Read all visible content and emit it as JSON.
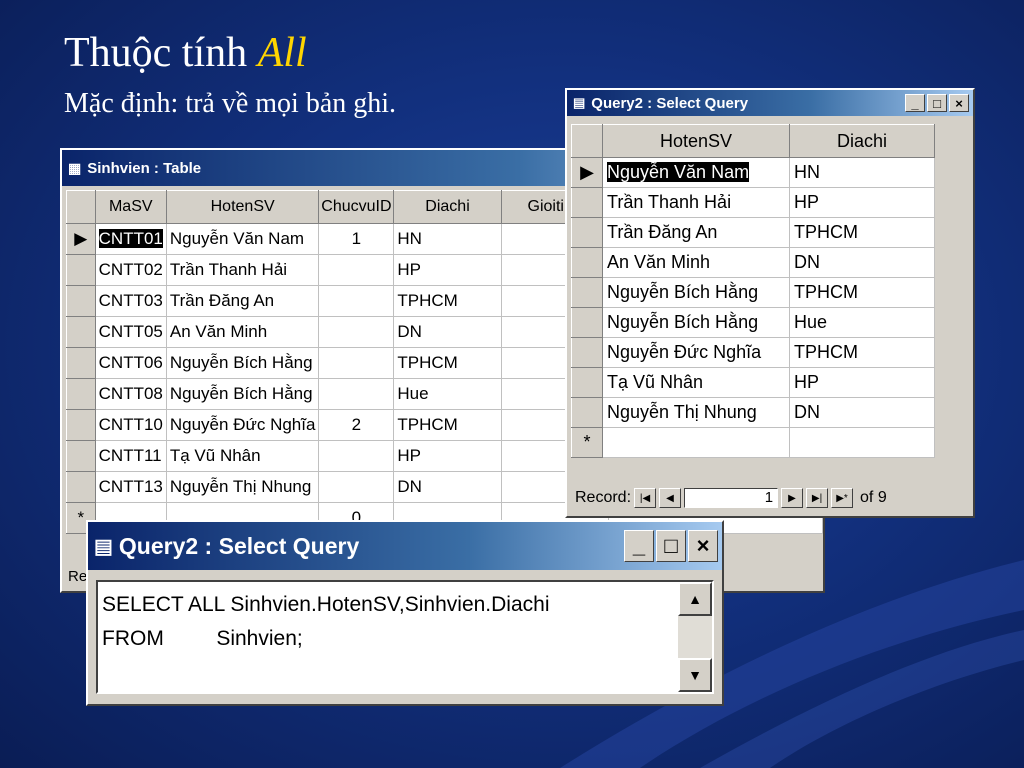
{
  "slide": {
    "title_prefix": "Thuộc tính ",
    "title_keyword": "All",
    "subtitle": "Mặc định: trả về mọi bản ghi."
  },
  "table_window": {
    "title": "Sinhvien : Table",
    "columns": [
      "MaSV",
      "HotenSV",
      "ChucvuID",
      "Diachi",
      "Gioitinh"
    ],
    "rows": [
      [
        "CNTT01",
        "Nguyễn Văn Nam",
        "1",
        "HN",
        ""
      ],
      [
        "CNTT02",
        "Trần Thanh Hải",
        "",
        "HP",
        ""
      ],
      [
        "CNTT03",
        "Trần Đăng An",
        "",
        "TPHCM",
        ""
      ],
      [
        "CNTT05",
        "An Văn Minh",
        "",
        "DN",
        ""
      ],
      [
        "CNTT06",
        "Nguyễn Bích Hằng",
        "",
        "TPHCM",
        ""
      ],
      [
        "CNTT08",
        "Nguyễn Bích Hằng",
        "",
        "Hue",
        ""
      ],
      [
        "CNTT10",
        "Nguyễn Đức Nghĩa",
        "2",
        "TPHCM",
        ""
      ],
      [
        "CNTT11",
        "Tạ Vũ Nhân",
        "",
        "HP",
        ""
      ],
      [
        "CNTT13",
        "Nguyễn Thị Nhung",
        "",
        "DN",
        ""
      ]
    ],
    "new_row_marker": "*",
    "new_row_chucvuid": "0",
    "current_row_marker": "▶",
    "status_partial": "Re"
  },
  "query_window": {
    "title": "Query2 : Select Query",
    "columns": [
      "HotenSV",
      "Diachi"
    ],
    "rows": [
      [
        "Nguyễn Văn Nam",
        "HN"
      ],
      [
        "Trần Thanh Hải",
        "HP"
      ],
      [
        "Trần Đăng An",
        "TPHCM"
      ],
      [
        "An Văn Minh",
        "DN"
      ],
      [
        "Nguyễn Bích Hằng",
        "TPHCM"
      ],
      [
        "Nguyễn Bích Hằng",
        "Hue"
      ],
      [
        "Nguyễn Đức Nghĩa",
        "TPHCM"
      ],
      [
        "Tạ Vũ Nhân",
        "HP"
      ],
      [
        "Nguyễn Thị Nhung",
        "DN"
      ]
    ],
    "new_row_marker": "*",
    "current_row_marker": "▶",
    "record_label": "Record:",
    "record_value": "1",
    "of_label": "of 9"
  },
  "sql_window": {
    "title": "Query2 : Select Query",
    "line1": "SELECT ALL Sinhvien.HotenSV,Sinhvien.Diachi",
    "line2": "FROM         Sinhvien;"
  }
}
